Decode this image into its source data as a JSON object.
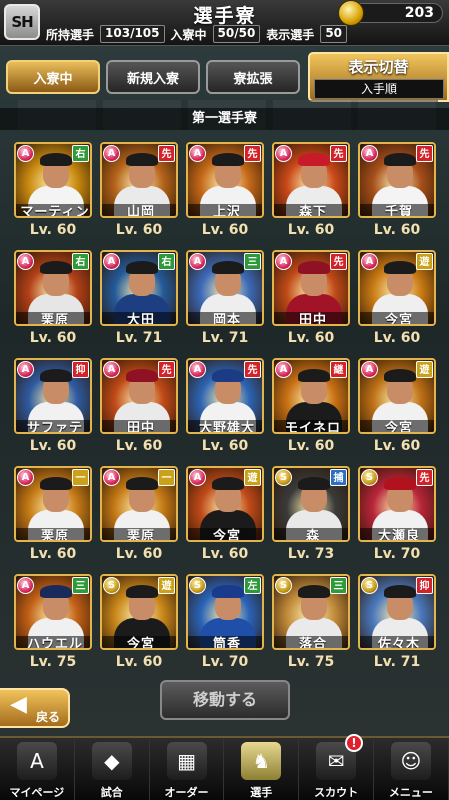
{
  "header": {
    "logo_text": "SH",
    "title": "選手寮",
    "coins": "203",
    "owned_label": "所持選手",
    "owned_value": "103/105",
    "in_dorm_label": "入寮中",
    "in_dorm_value": "50/50",
    "shown_label": "表示選手",
    "shown_value": "50"
  },
  "tabs": [
    {
      "label": "入寮中",
      "active": true
    },
    {
      "label": "新規入寮",
      "active": false
    },
    {
      "label": "寮拡張",
      "active": false
    }
  ],
  "display_toggle": {
    "label": "表示切替",
    "sort": "入手順"
  },
  "dorm_name": "第一選手寮",
  "players": [
    {
      "name": "マーティン",
      "lv": "Lv. 60",
      "rank": "A",
      "pos": "右",
      "pos_color": "#2f9a3a",
      "bg": "#c98a10",
      "cap": "#1b1b1b",
      "body": "#f4f4f4"
    },
    {
      "name": "山岡",
      "lv": "Lv. 60",
      "rank": "A",
      "pos": "先",
      "pos_color": "#d2232a",
      "bg": "#b4631a",
      "cap": "#1b1b1b",
      "body": "#eaeaea"
    },
    {
      "name": "上沢",
      "lv": "Lv. 60",
      "rank": "A",
      "pos": "先",
      "pos_color": "#d2232a",
      "bg": "#c46818",
      "cap": "#1b1b1b",
      "body": "#f2f2f2"
    },
    {
      "name": "森下",
      "lv": "Lv. 60",
      "rank": "A",
      "pos": "先",
      "pos_color": "#d2232a",
      "bg": "#c84818",
      "cap": "#c81a28",
      "body": "#ececec"
    },
    {
      "name": "千賀",
      "lv": "Lv. 60",
      "rank": "A",
      "pos": "先",
      "pos_color": "#d2232a",
      "bg": "#a64e1a",
      "cap": "#1b1b1b",
      "body": "#f4f4f4"
    },
    {
      "name": "栗原",
      "lv": "Lv. 60",
      "rank": "A",
      "pos": "右",
      "pos_color": "#2f9a3a",
      "bg": "#b24018",
      "cap": "#1b1b1b",
      "body": "#e6e6e6"
    },
    {
      "name": "大田",
      "lv": "Lv. 71",
      "rank": "A",
      "pos": "右",
      "pos_color": "#2f9a3a",
      "bg": "#245a9a",
      "cap": "#1b1b1b",
      "body": "#1d3f82"
    },
    {
      "name": "岡本",
      "lv": "Lv. 71",
      "rank": "A",
      "pos": "三",
      "pos_color": "#2f9a3a",
      "bg": "#3b6ab8",
      "cap": "#1b1b1b",
      "body": "#eeeeee"
    },
    {
      "name": "田中",
      "lv": "Lv. 60",
      "rank": "A",
      "pos": "先",
      "pos_color": "#d2232a",
      "bg": "#c04a18",
      "cap": "#8e1224",
      "body": "#a11428"
    },
    {
      "name": "今宮",
      "lv": "Lv. 60",
      "rank": "A",
      "pos": "遊",
      "pos_color": "#c9a21a",
      "bg": "#c97a14",
      "cap": "#1b1b1b",
      "body": "#efefef"
    },
    {
      "name": "サファテ",
      "lv": "Lv. 60",
      "rank": "A",
      "pos": "抑",
      "pos_color": "#d2232a",
      "bg": "#2e5aa0",
      "cap": "#1b1b1b",
      "body": "#f1f1f1"
    },
    {
      "name": "田中",
      "lv": "Lv. 60",
      "rank": "A",
      "pos": "先",
      "pos_color": "#d2232a",
      "bg": "#c04a18",
      "cap": "#8e1224",
      "body": "#eaeaea"
    },
    {
      "name": "大野雄大",
      "lv": "Lv. 60",
      "rank": "A",
      "pos": "先",
      "pos_color": "#d2232a",
      "bg": "#2d64b2",
      "cap": "#1b3c84",
      "body": "#f2f2f2"
    },
    {
      "name": "モイネロ",
      "lv": "Lv. 60",
      "rank": "A",
      "pos": "継",
      "pos_color": "#d2232a",
      "bg": "#c77014",
      "cap": "#1b1b1b",
      "body": "#1b1b1b"
    },
    {
      "name": "今宮",
      "lv": "Lv. 60",
      "rank": "A",
      "pos": "遊",
      "pos_color": "#c9a21a",
      "bg": "#bd7016",
      "cap": "#1b1b1b",
      "body": "#f1f1f1"
    },
    {
      "name": "栗原",
      "lv": "Lv. 60",
      "rank": "A",
      "pos": "一",
      "pos_color": "#c9a21a",
      "bg": "#c57a16",
      "cap": "#1b1b1b",
      "body": "#f1f1f1"
    },
    {
      "name": "栗原",
      "lv": "Lv. 60",
      "rank": "A",
      "pos": "一",
      "pos_color": "#c9a21a",
      "bg": "#c57a16",
      "cap": "#1b1b1b",
      "body": "#f1f1f1"
    },
    {
      "name": "今宮",
      "lv": "Lv. 60",
      "rank": "A",
      "pos": "遊",
      "pos_color": "#c9a21a",
      "bg": "#c04a18",
      "cap": "#1b1b1b",
      "body": "#1b1b1b"
    },
    {
      "name": "森",
      "lv": "Lv. 73",
      "rank": "S",
      "pos": "捕",
      "pos_color": "#2f6fc0",
      "bg": "#3a3a3a",
      "cap": "#1b1b1b",
      "body": "#e9e9e9"
    },
    {
      "name": "大瀬良",
      "lv": "Lv. 70",
      "rank": "S",
      "pos": "先",
      "pos_color": "#d2232a",
      "bg": "#b8253a",
      "cap": "#b0121e",
      "body": "#f1f1f1"
    },
    {
      "name": "ハウエル",
      "lv": "Lv. 75",
      "rank": "A",
      "pos": "三",
      "pos_color": "#2f9a3a",
      "bg": "#c26016",
      "cap": "#1a2a5a",
      "body": "#f0f0f0"
    },
    {
      "name": "今宮",
      "lv": "Lv. 60",
      "rank": "S",
      "pos": "遊",
      "pos_color": "#c9a21a",
      "bg": "#c8861a",
      "cap": "#1b1b1b",
      "body": "#1b1b1b"
    },
    {
      "name": "筒香",
      "lv": "Lv. 70",
      "rank": "S",
      "pos": "左",
      "pos_color": "#2f9a3a",
      "bg": "#2a63b6",
      "cap": "#1a3a8c",
      "body": "#1f4fa8"
    },
    {
      "name": "落合",
      "lv": "Lv. 75",
      "rank": "S",
      "pos": "三",
      "pos_color": "#2f9a3a",
      "bg": "#c08a3a",
      "cap": "#1b1b1b",
      "body": "#eaeaea"
    },
    {
      "name": "佐々木",
      "lv": "Lv. 71",
      "rank": "S",
      "pos": "抑",
      "pos_color": "#d2232a",
      "bg": "#4a78bc",
      "cap": "#1b1b1b",
      "body": "#ececec"
    }
  ],
  "move_button": "移動する",
  "back_button": "戻る",
  "nav": [
    {
      "label": "マイページ",
      "icon": "A",
      "active": false
    },
    {
      "label": "試合",
      "icon": "◆",
      "active": false
    },
    {
      "label": "オーダー",
      "icon": "▦",
      "active": false
    },
    {
      "label": "選手",
      "icon": "♞",
      "active": true
    },
    {
      "label": "スカウト",
      "icon": "✉",
      "active": false,
      "badge": "!"
    },
    {
      "label": "メニュー",
      "icon": "☺",
      "active": false
    }
  ]
}
